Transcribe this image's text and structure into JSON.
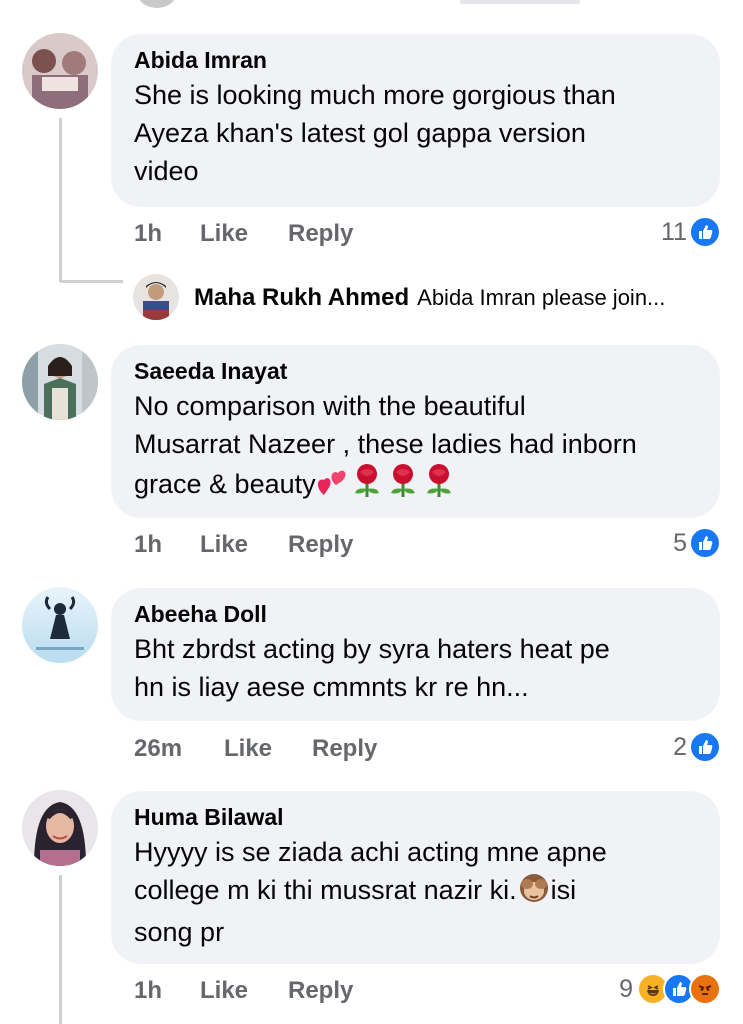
{
  "comments": [
    {
      "name": "Abida Imran",
      "lines": [
        "She is looking much more gorgious than",
        "Ayeza khan's latest gol gappa version",
        "video"
      ],
      "time": "1h",
      "like_label": "Like",
      "reply_label": "Reply",
      "reaction_count": "11",
      "reactions": [
        "like-icon"
      ]
    },
    {
      "name": "Saeeda Inayat",
      "lines": [
        "No comparison with the beautiful",
        "Musarrat Nazeer , these ladies had inborn",
        "grace & beauty"
      ],
      "time": "1h",
      "like_label": "Like",
      "reply_label": "Reply",
      "reaction_count": "5",
      "reactions": [
        "like-icon"
      ]
    },
    {
      "name": "Abeeha Doll",
      "lines": [
        "Bht zbrdst acting by syra haters heat pe",
        "hn is liay aese cmmnts kr re hn..."
      ],
      "time": "26m",
      "like_label": "Like",
      "reply_label": "Reply",
      "reaction_count": "2",
      "reactions": [
        "like-icon"
      ]
    },
    {
      "name": "Huma Bilawal",
      "lines": [
        "Hyyyy is se ziada achi acting mne apne",
        "college m ki thi mussrat nazir ki.",
        "song pr"
      ],
      "line2_suffix": "isi",
      "time": "1h",
      "like_label": "Like",
      "reply_label": "Reply",
      "reaction_count": "9",
      "reactions": [
        "haha-icon",
        "like-icon",
        "angry-icon"
      ]
    }
  ],
  "reply_preview": {
    "name": "Maha Rukh Ahmed",
    "text": "Abida Imran please join..."
  },
  "colors": {
    "bubble": "#f0f2f5",
    "meta": "#65676b",
    "like": "#1877f2",
    "thread": "#ced0d4"
  }
}
